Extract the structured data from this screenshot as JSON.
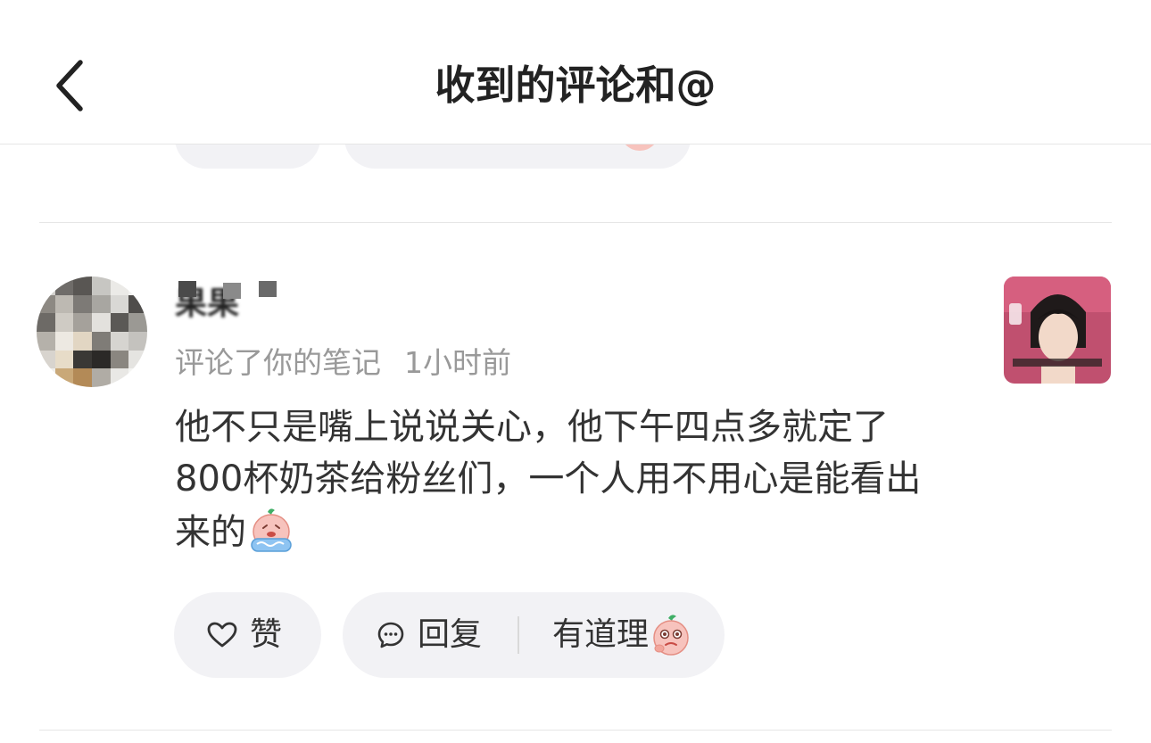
{
  "header": {
    "title": "收到的评论和@"
  },
  "comment": {
    "username": "果果",
    "action": "评论了你的笔记",
    "time": "1小时前",
    "content": "他不只是嘴上说说关心，他下午四点多就定了800杯奶茶给粉丝们，一个人用不用心是能看出来的",
    "inline_emoji": "crying-peach-emoji"
  },
  "actions": {
    "like_label": "赞",
    "reply_label": "回复",
    "quick_reply_label": "有道理",
    "quick_reply_emoji": "thinking-peach-emoji"
  },
  "colors": {
    "pill_background": "#f2f2f5",
    "secondary_text": "#999999",
    "primary_text": "#333333"
  }
}
